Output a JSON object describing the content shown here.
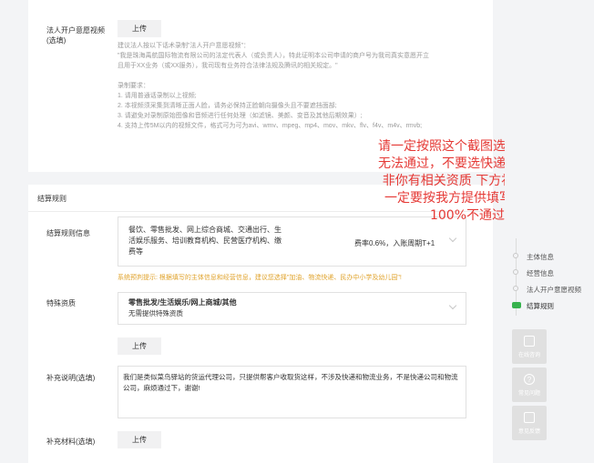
{
  "video_section": {
    "label_line1": "法人开户意愿视频",
    "label_line2": "(选填)",
    "upload_label": "上传",
    "tip_lines": [
      "建议法人按以下话术录制\"法人开户意愿视频\"：",
      "\"我是珠海禹航国际物流有限公司的法定代表人（或负责人），特此证明本公司申请的商户号为我司真实意愿开立",
      "且用于XX业务（或XX服务），我司现有业务符合法律法规及腾讯的相关规定。\"",
      "",
      "录制要求：",
      "1. 请用普通话录制以上视频;",
      "2. 本视频须采集到清晰正面人脸，请务必保持正脸朝向摄像头且不要遮挡面部;",
      "3. 请避免对录制原始图像和音频进行任何处理（如滤镜、美颜、变音及其他后期效果）;",
      "4. 支持上传5M以内的视频文件，格式可为可为avi、wmv、mpeg、mp4、mov、mkv、flv、f4v、m4v、rmvb;"
    ]
  },
  "settlement": {
    "section_title": "结算规则",
    "rule_label": "结算规则信息",
    "rule_categories": [
      "餐饮、零售批发、网上综合商城、交通出行、生",
      "活娱乐服务、培训教育机构、民营医疗机构、缴",
      "费等"
    ],
    "rule_rate": "费率0.6%，入账周期T+1",
    "hint": "系统预判提示: 根据填写的主体信息和经营信息，建议您选择\"加油、物流快递、民办中小学及幼儿园\"!",
    "qual_label": "特殊资质",
    "qual_title": "零售批发/生活娱乐/网上商城/其他",
    "qual_desc": "无需提供特殊资质",
    "qual_upload": "上传",
    "supplement_label": "补充说明(选填)",
    "supplement_text": "我们是类似菜鸟驿站的货运代理公司，只提供帮客户收取货这样，不涉及快递和物流业务，不是快递公司和物流公司，麻烦通过下，谢谢!",
    "material_label": "补充材料(选填)",
    "material_upload": "上传"
  },
  "annotation": {
    "text": "请一定按照这个截图选择，否则无法通过，不要选快递物流，除非你有相关资质 下方补充说明一定要按我方提供填写，否则100%不通过",
    "color": "#e53935"
  },
  "side_nav": {
    "steps": [
      "主体信息",
      "经营信息",
      "法人开户意愿视频",
      "结算规则"
    ],
    "active_step": "结算规则",
    "active_color": "#37b24d"
  },
  "float_tools": [
    {
      "icon": "chat-icon",
      "label": "在线咨询"
    },
    {
      "icon": "help-icon",
      "label": "常见问题"
    },
    {
      "icon": "edit-icon",
      "label": "意见反馈"
    }
  ]
}
